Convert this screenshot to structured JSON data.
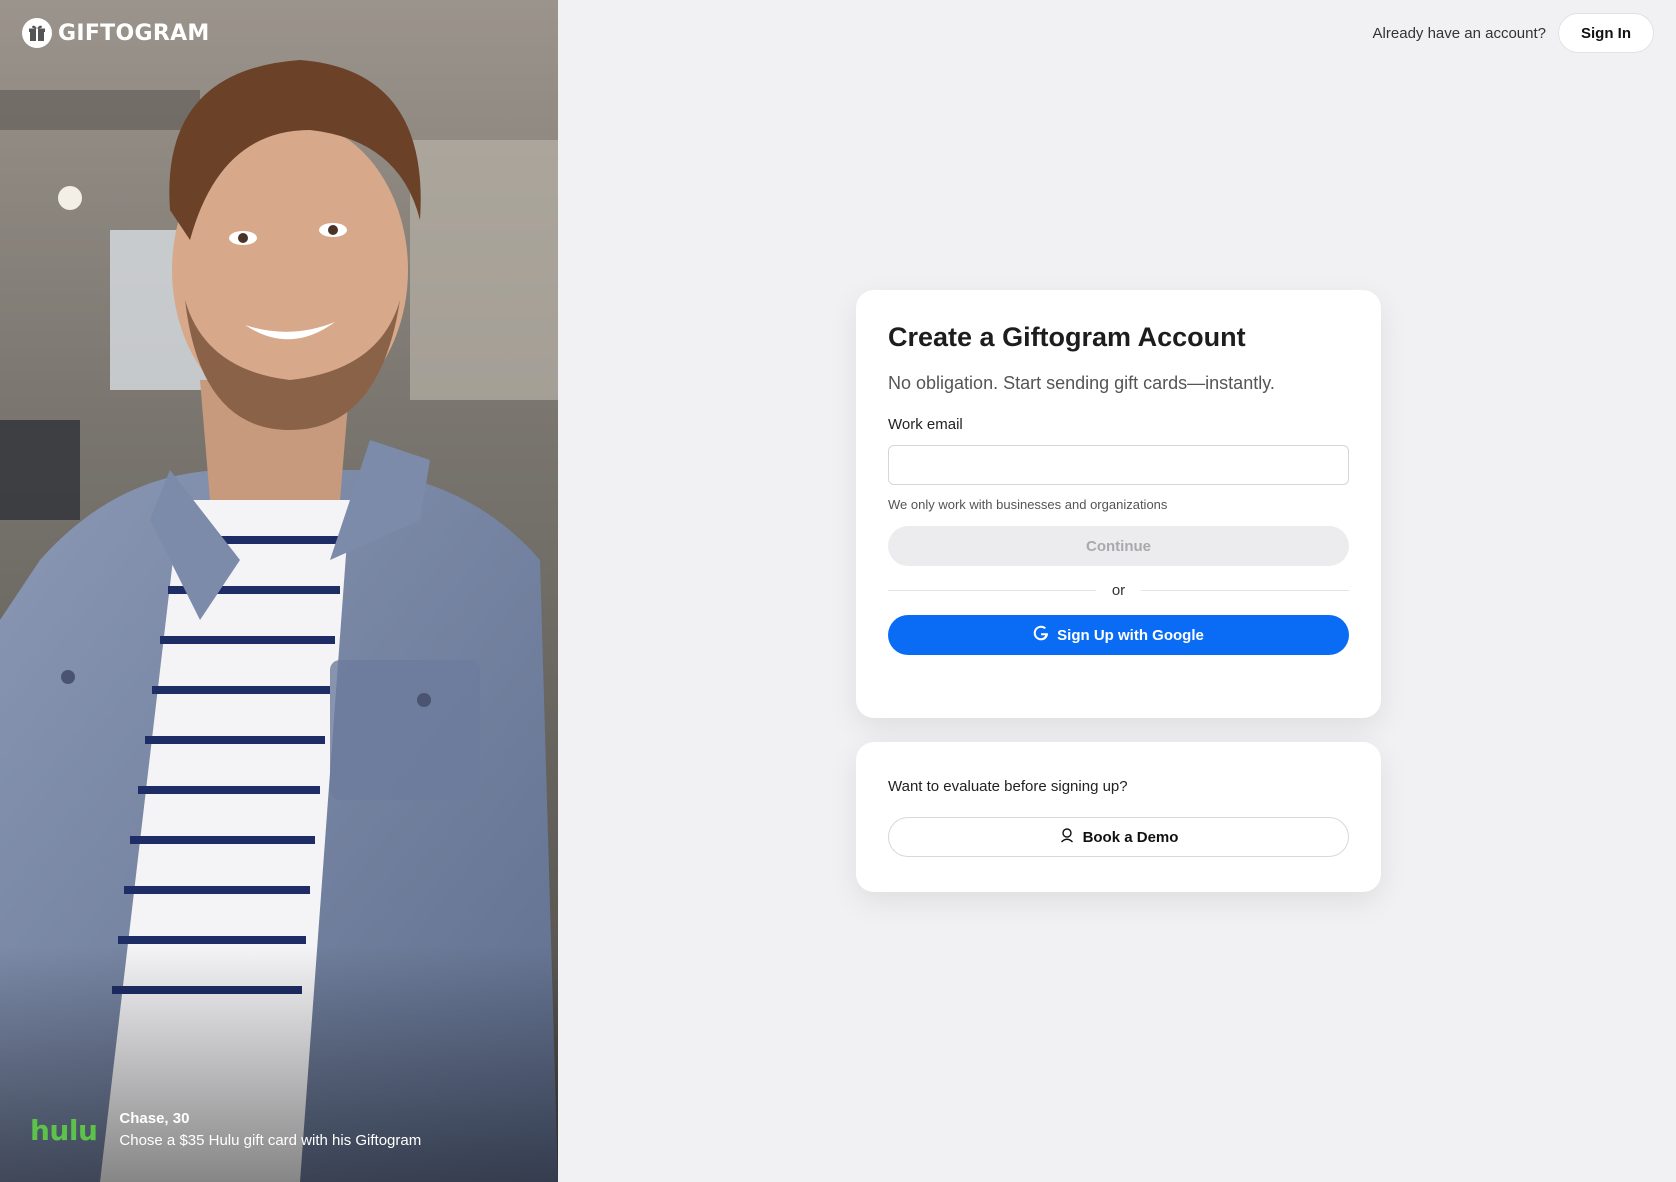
{
  "brand": {
    "logo_text": "GIFTOGRAM"
  },
  "topbar": {
    "prompt": "Already have an account?",
    "signin_label": "Sign In"
  },
  "testimonial": {
    "brand_name": "hulu",
    "name_age": "Chase, 30",
    "text": "Chose a $35 Hulu gift card with his Giftogram"
  },
  "signup": {
    "title": "Create a Giftogram Account",
    "subtitle": "No obligation. Start sending gift cards—instantly.",
    "email_label": "Work email",
    "email_value": "",
    "email_placeholder": "",
    "hint": "We only work with businesses and organizations",
    "continue_label": "Continue",
    "divider_text": "or",
    "google_label": "Sign Up with Google"
  },
  "demo": {
    "prompt": "Want to evaluate before signing up?",
    "button_label": "Book a Demo"
  },
  "colors": {
    "primary": "#0a6cf5",
    "page_bg": "#f1f1f3",
    "hulu_green": "#5cc24a",
    "disabled_bg": "#ececee"
  },
  "icons": [
    "gift-icon",
    "google-icon",
    "user-icon"
  ]
}
